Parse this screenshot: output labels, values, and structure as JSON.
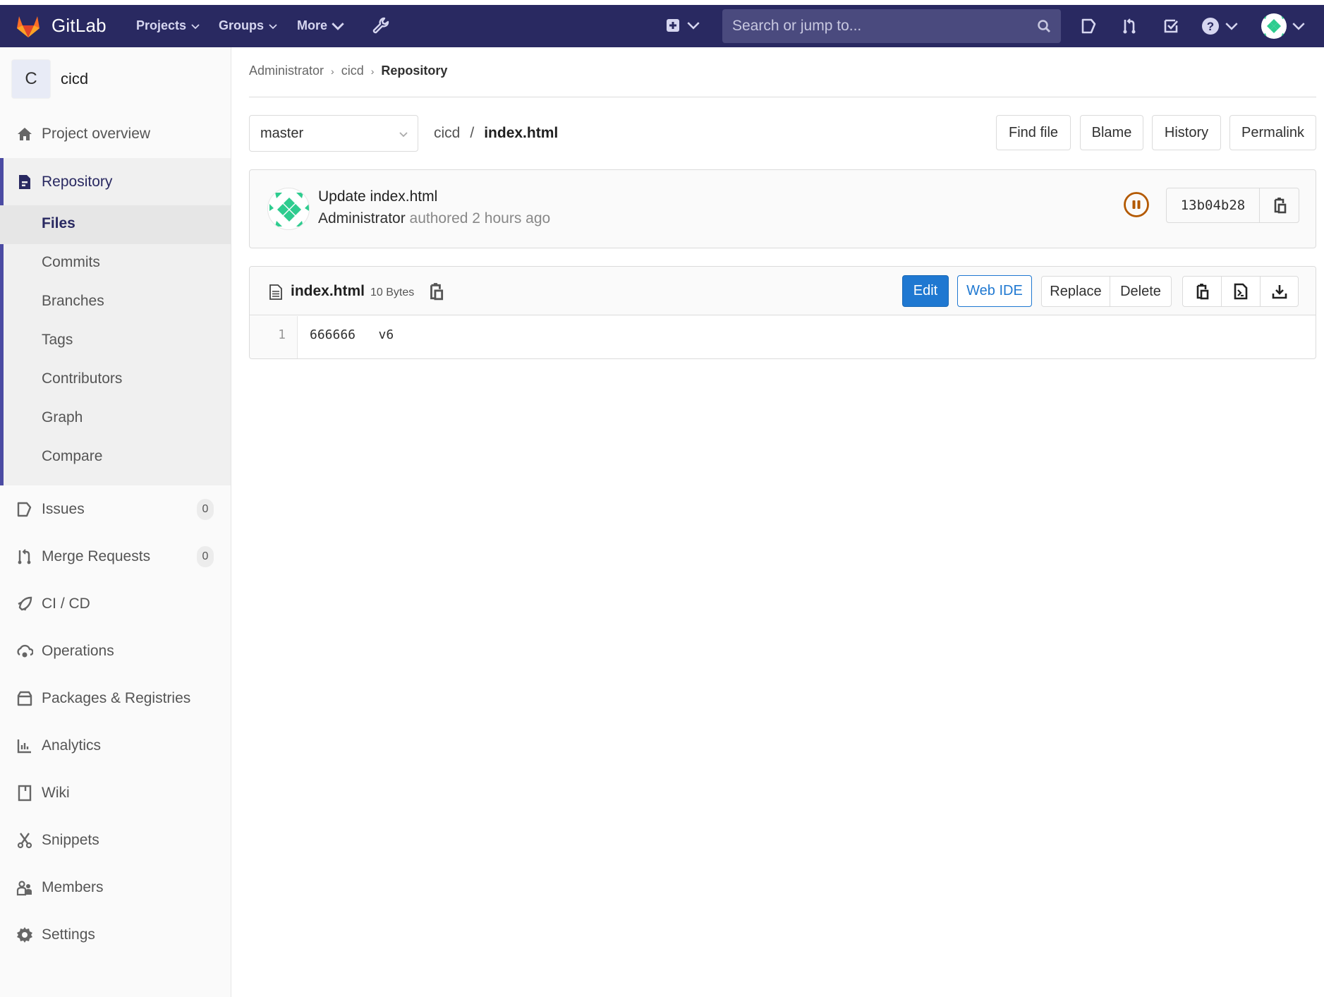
{
  "header": {
    "brand": "GitLab",
    "nav": [
      {
        "label": "Projects"
      },
      {
        "label": "Groups"
      },
      {
        "label": "More"
      }
    ],
    "search_placeholder": "Search or jump to...",
    "icons": [
      "plus-square-icon",
      "issues-icon",
      "merge-request-icon",
      "todo-icon",
      "help-icon"
    ],
    "colors": {
      "bar": "#292961",
      "search": "#4a4a7e"
    }
  },
  "sidebar": {
    "project_initial": "C",
    "project_name": "cicd",
    "overview": "Project overview",
    "repository": {
      "label": "Repository",
      "children": [
        "Files",
        "Commits",
        "Branches",
        "Tags",
        "Contributors",
        "Graph",
        "Compare"
      ],
      "active_child": "Files"
    },
    "items": [
      {
        "label": "Issues",
        "badge": "0"
      },
      {
        "label": "Merge Requests",
        "badge": "0"
      },
      {
        "label": "CI / CD"
      },
      {
        "label": "Operations"
      },
      {
        "label": "Packages & Registries"
      },
      {
        "label": "Analytics"
      },
      {
        "label": "Wiki"
      },
      {
        "label": "Snippets"
      },
      {
        "label": "Members"
      },
      {
        "label": "Settings"
      }
    ],
    "colors": {
      "active_border": "#4b4ba3",
      "active_text": "#292961"
    }
  },
  "breadcrumb": [
    "Administrator",
    "cicd",
    "Repository"
  ],
  "file_nav": {
    "branch": "master",
    "path_root": "cicd",
    "path_sep": "/",
    "file": "index.html",
    "buttons": [
      "Find file",
      "Blame",
      "History",
      "Permalink"
    ]
  },
  "commit": {
    "title": "Update index.html",
    "author": "Administrator",
    "meta": "authored 2 hours ago",
    "pipeline_status": "paused",
    "sha": "13b04b28",
    "colors": {
      "pipeline": "#b35900"
    }
  },
  "file": {
    "name": "index.html",
    "size": "10 Bytes",
    "buttons": {
      "edit": "Edit",
      "web_ide": "Web IDE",
      "replace": "Replace",
      "delete": "Delete"
    },
    "lines": [
      {
        "number": "1",
        "text": "666666   v6"
      }
    ],
    "colors": {
      "primary": "#1f78d1"
    }
  }
}
